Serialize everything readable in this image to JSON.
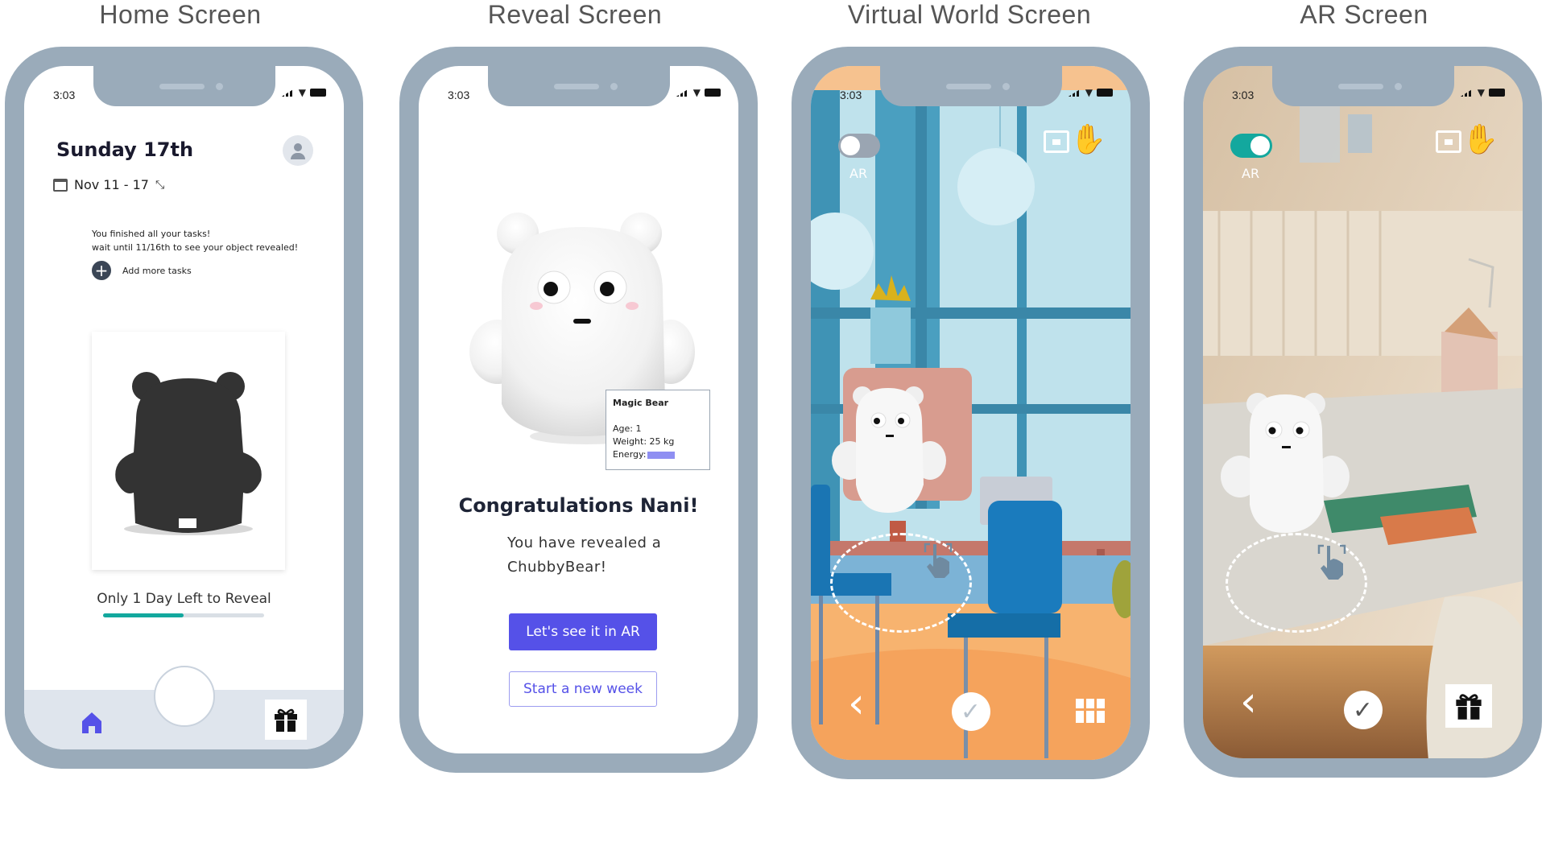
{
  "screens": {
    "home": {
      "title": "Home Screen",
      "status_time": "3:03",
      "heading": "Sunday 17th",
      "date_range": "Nov 11 -  17",
      "tasks_message_line1": "You finished all your tasks!",
      "tasks_message_line2": "wait until 11/16th to see your object revealed!",
      "add_tasks_label": "Add more tasks",
      "days_left": "Only 1 Day Left to Reveal",
      "progress": 0.5
    },
    "reveal": {
      "title": "Reveal Screen",
      "status_time": "3:03",
      "card_title": "Magic Bear",
      "card_age": "Age: 1",
      "card_weight": "Weight: 25 kg",
      "card_energy_label": "Energy:",
      "congrats": "Congratulations Nani!",
      "message_line1": "You have revealed a",
      "message_line2": "ChubbyBear!",
      "primary_button": "Let's see it in AR",
      "secondary_button": "Start a new week"
    },
    "virtual_world": {
      "title": "Virtual World Screen",
      "status_time": "3:03",
      "toggle_label": "AR",
      "ar_enabled": false
    },
    "ar": {
      "title": "AR Screen",
      "status_time": "3:03",
      "toggle_label": "AR",
      "ar_enabled": true
    }
  },
  "colors": {
    "phone_frame": "#9aabba",
    "accent_purple": "#5551e8",
    "progress_teal": "#13a89e",
    "toggle_on": "#13a89e",
    "toggle_off": "#9aa5b2"
  },
  "icons": [
    "signal-icon",
    "wifi-icon",
    "battery-icon",
    "avatar-icon",
    "calendar-icon",
    "expand-icon",
    "plus-icon",
    "home-icon",
    "gift-icon",
    "frame-icon",
    "hand-icon",
    "back-icon",
    "check-icon",
    "touch-icon",
    "toolbox-icon"
  ]
}
